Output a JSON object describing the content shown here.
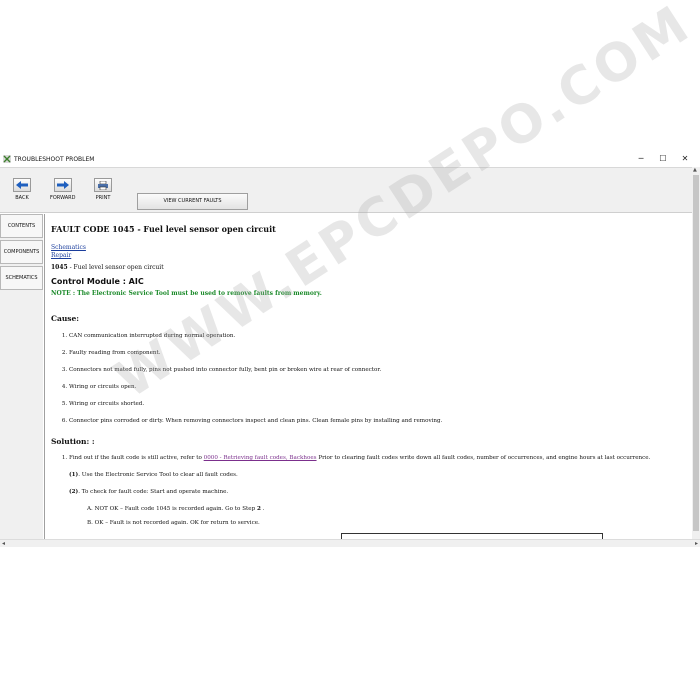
{
  "window": {
    "title": "TROUBLESHOOT PROBLEM",
    "controls": [
      "─",
      "☐",
      "✕"
    ]
  },
  "toolbar": {
    "back_label": "BACK",
    "forward_label": "FORWARD",
    "print_label": "PRINT",
    "view_faults_label": "VIEW CURRENT FAULTS"
  },
  "side_tabs": [
    "CONTENTS",
    "COMPONENTS",
    "SCHEMATICS"
  ],
  "content": {
    "title_code": "FAULT CODE 1045",
    "title_rest": " - Fuel level sensor open circuit",
    "links": [
      "Schematics",
      "Repair"
    ],
    "desc_code": "1045",
    "desc_rest": " - Fuel level sensor open circuit",
    "control_module": "Control Module : AIC",
    "note": "NOTE : The Electronic Service Tool must be used to remove faults from memory.",
    "cause_heading": "Cause:",
    "causes": [
      "CAN communication interrupted during normal operation.",
      "Faulty reading from component.",
      "Connectors not mated fully, pins not pushed into connector fully, bent pin or broken wire at rear of connector.",
      "Wiring or circuits open.",
      "Wiring or circuits shorted.",
      "Connector pins corroded or dirty. When removing connectors inspect and clean pins. Clean female pins by installing and removing."
    ],
    "solution_heading": "Solution: :",
    "solution_1_pre": "Find out if the fault code is still active, refer to ",
    "solution_1_link": "0000 - Retrieving fault codes, Backhoes",
    "solution_1_post": " Prior to clearing fault codes write down all fault codes, number of occurrences, and engine hours at last occurrence.",
    "step1_num": "(1)",
    "step1_text": ". Use the Electronic Service Tool to clear all fault codes.",
    "step2_num": "(2)",
    "step2_text": ". To check for fault code: Start and operate machine.",
    "a_pre": "A. NOT OK – Fault code 1045 is recorded again. Go to Step ",
    "a_bold": "2",
    "a_post": " .",
    "b_text": "B. OK – Fault is not recorded again. OK for return to service."
  },
  "watermark": "WWW.EPCDEPO.COM",
  "colors": {
    "link": "#1a3d9c",
    "visited_link": "#7b2f8c",
    "note_green": "#1b8a2a",
    "toolbar_icon_blue": "#1e5fbf"
  }
}
